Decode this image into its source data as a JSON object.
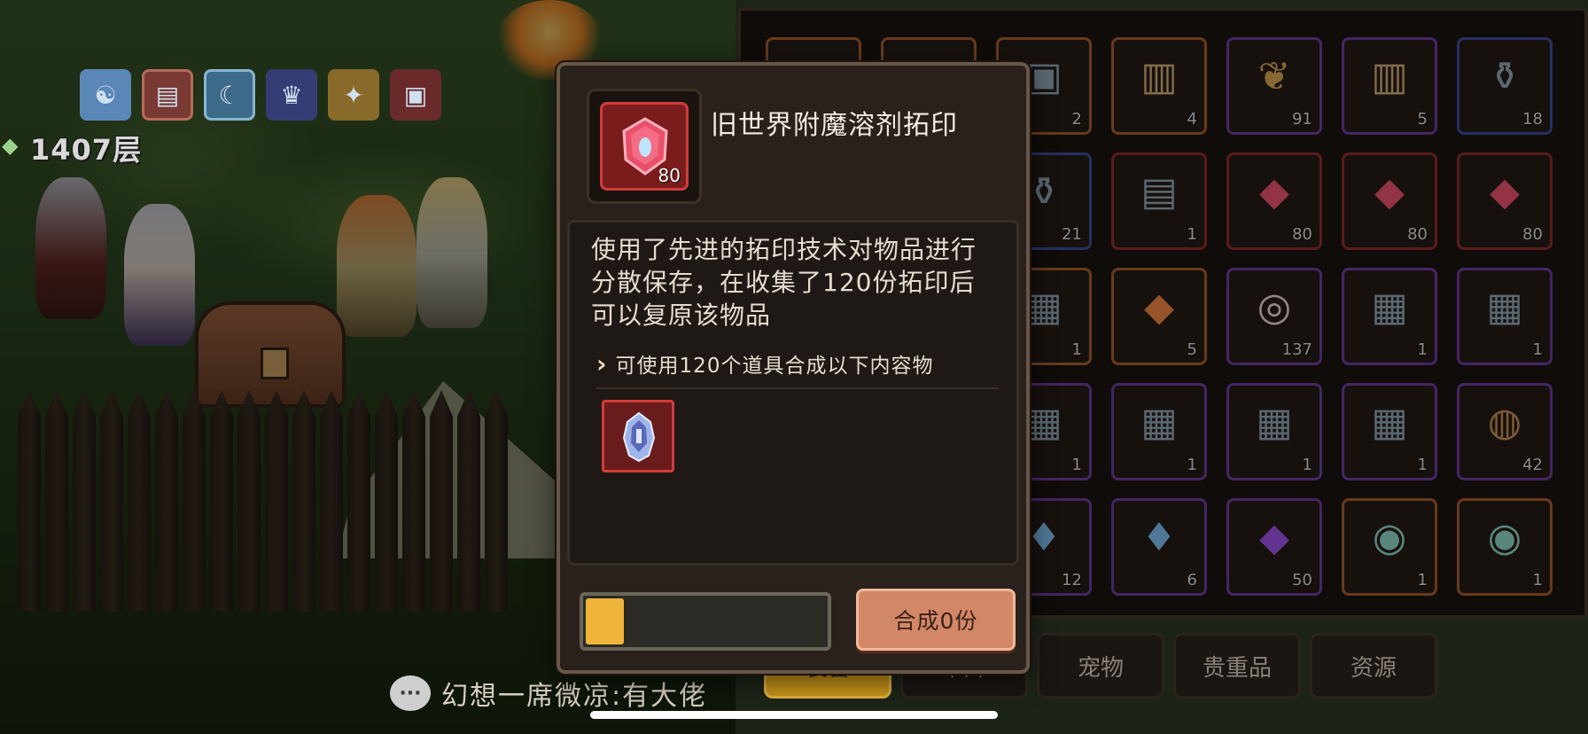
{
  "scene": {
    "floor_label": "1407层",
    "status_icons": [
      "status-icon-1",
      "status-icon-2",
      "status-icon-3",
      "status-icon-4",
      "status-icon-5",
      "status-icon-6"
    ]
  },
  "chat": {
    "message": "幻想一席微凉:有大佬"
  },
  "inventory": {
    "slots": [
      {
        "icon": "blank-slot",
        "count": "",
        "rarity": "orange"
      },
      {
        "icon": "blank-slot",
        "count": "",
        "rarity": "orange"
      },
      {
        "icon": "pet-card",
        "count": "2",
        "rarity": "orange"
      },
      {
        "icon": "treasure-chest",
        "count": "4",
        "rarity": "orange"
      },
      {
        "icon": "fruit-basket",
        "count": "91",
        "rarity": "purple"
      },
      {
        "icon": "treasure-chest",
        "count": "5",
        "rarity": "purple"
      },
      {
        "icon": "potion-jar",
        "count": "18",
        "rarity": "blue"
      },
      {
        "icon": "blank-slot",
        "count": "",
        "rarity": "red"
      },
      {
        "icon": "blank-slot",
        "count": "",
        "rarity": "red"
      },
      {
        "icon": "potion-jar",
        "count": "21",
        "rarity": "blue"
      },
      {
        "icon": "scroll",
        "count": "1",
        "rarity": "red"
      },
      {
        "icon": "red-gem-rubbing",
        "count": "80",
        "rarity": "red"
      },
      {
        "icon": "red-gem-rubbing",
        "count": "80",
        "rarity": "red"
      },
      {
        "icon": "red-gem-rubbing",
        "count": "80",
        "rarity": "red"
      },
      {
        "icon": "blank-slot",
        "count": "",
        "rarity": "orange"
      },
      {
        "icon": "blank-slot",
        "count": "",
        "rarity": "orange"
      },
      {
        "icon": "map-scroll",
        "count": "1",
        "rarity": "orange"
      },
      {
        "icon": "orange-gem",
        "count": "5",
        "rarity": "orange"
      },
      {
        "icon": "shell",
        "count": "137",
        "rarity": "purple"
      },
      {
        "icon": "map-scroll",
        "count": "1",
        "rarity": "purple"
      },
      {
        "icon": "map-scroll",
        "count": "1",
        "rarity": "purple"
      },
      {
        "icon": "blank-slot",
        "count": "",
        "rarity": "purple"
      },
      {
        "icon": "blank-slot",
        "count": "",
        "rarity": "purple"
      },
      {
        "icon": "map-scroll",
        "count": "1",
        "rarity": "purple"
      },
      {
        "icon": "map-scroll",
        "count": "1",
        "rarity": "purple"
      },
      {
        "icon": "map-scroll",
        "count": "1",
        "rarity": "purple"
      },
      {
        "icon": "map-scroll",
        "count": "1",
        "rarity": "purple"
      },
      {
        "icon": "wood-log",
        "count": "42",
        "rarity": "purple"
      },
      {
        "icon": "blank-slot",
        "count": "",
        "rarity": "purple"
      },
      {
        "icon": "blank-slot",
        "count": "",
        "rarity": "purple"
      },
      {
        "icon": "blue-crystal",
        "count": "12",
        "rarity": "purple"
      },
      {
        "icon": "blue-crystal",
        "count": "6",
        "rarity": "purple"
      },
      {
        "icon": "purple-gem",
        "count": "50",
        "rarity": "purple"
      },
      {
        "icon": "glass-dome",
        "count": "1",
        "rarity": "orange"
      },
      {
        "icon": "glass-dome",
        "count": "1",
        "rarity": "orange"
      }
    ]
  },
  "tabs": [
    "装备",
    "卡片",
    "宠物",
    "贵重品",
    "资源"
  ],
  "popup": {
    "item_name": "旧世界附魔溶剂拓印",
    "item_count": "80",
    "description": "使用了先进的拓印技术对物品进行分散保存，在收集了120份拓印后可以复原该物品",
    "recipe_text": "可使用120个道具合成以下内容物",
    "result_item_icon": "crystal-helmet",
    "combine_button": "合成0份",
    "progress_fraction": 0.16
  },
  "colors": {
    "progress_fill": "#f0b43a",
    "combine_button": "#d28767",
    "rarity_red": "#d23c3c"
  }
}
